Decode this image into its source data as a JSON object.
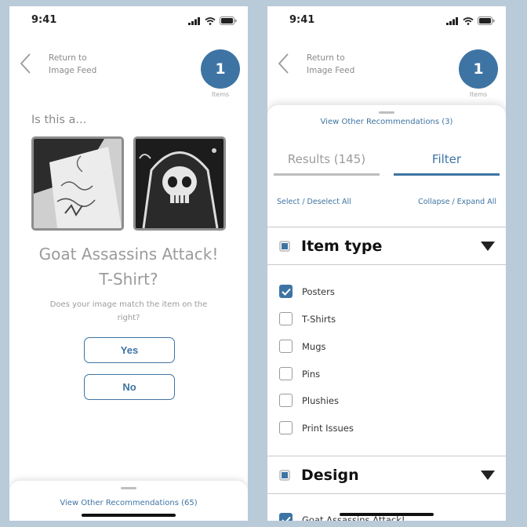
{
  "left_screen": {
    "status_time": "9:41",
    "back_label": "Return to Image Feed",
    "count": "1",
    "count_label": "Items",
    "question": "Is this a...",
    "product_title_line1": "Goat Assassins Attack!",
    "product_title_line2": "T-Shirt?",
    "match_question": "Does your image match the item on the right?",
    "yes_label": "Yes",
    "no_label": "No",
    "recommendations_link": "View Other Recommendations  (65)"
  },
  "right_screen": {
    "status_time": "9:41",
    "back_label": "Return to Image Feed",
    "count": "1",
    "count_label": "Items",
    "recommendations_link": "View Other Recommendations  (3)",
    "tabs": [
      {
        "label": "Results (145)",
        "active": false
      },
      {
        "label": "Filter",
        "active": true
      }
    ],
    "select_all": "Select / Deselect All",
    "collapse_all": "Collapse / Expand All",
    "sections": [
      {
        "title": "Item type",
        "options": [
          {
            "label": "Posters",
            "checked": true
          },
          {
            "label": "T-Shirts",
            "checked": false
          },
          {
            "label": "Mugs",
            "checked": false
          },
          {
            "label": "Pins",
            "checked": false
          },
          {
            "label": "Plushies",
            "checked": false
          },
          {
            "label": "Print Issues",
            "checked": false
          }
        ]
      },
      {
        "title": "Design",
        "options": [
          {
            "label": "Goat Assassins Attack!",
            "checked": true
          }
        ]
      }
    ]
  },
  "colors": {
    "accent": "#3e74a3",
    "background": "#b9cad9",
    "muted_text": "#9b9b9b"
  },
  "icons": [
    "chevron-left-icon",
    "signal-icon",
    "wifi-icon",
    "battery-icon",
    "caret-down-icon",
    "checkmark-icon"
  ]
}
